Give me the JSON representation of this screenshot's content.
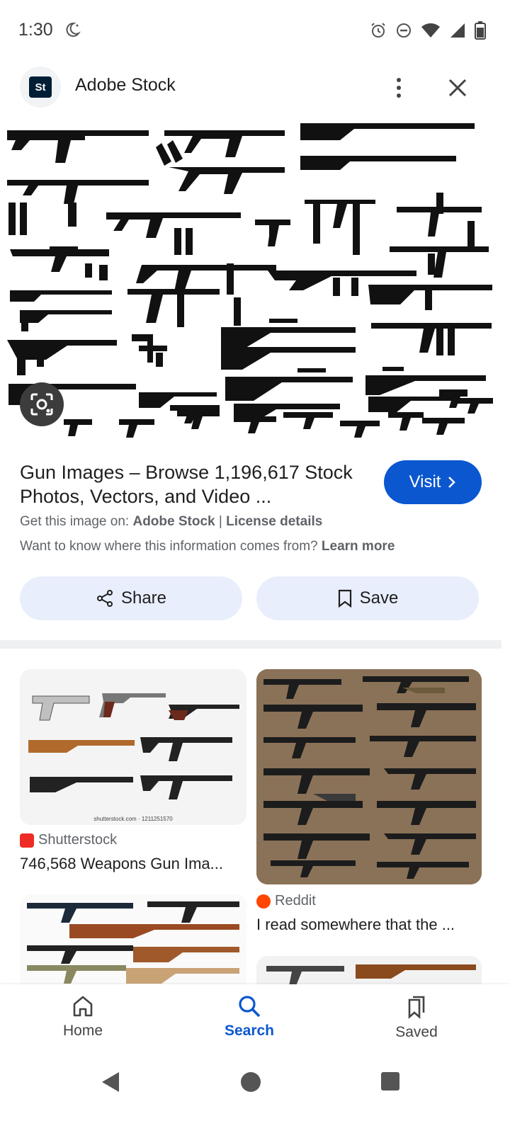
{
  "status_bar": {
    "time": "1:30"
  },
  "header": {
    "source_logo_text": "St",
    "title": "Adobe Stock"
  },
  "result": {
    "title": "Gun Images – Browse 1,196,617 Stock Photos, Vectors, and Video ...",
    "visit_label": "Visit",
    "get_prefix": "Get this image on: ",
    "get_source": "Adobe Stock",
    "get_separator": " | ",
    "license_label": "License details",
    "know_text": "Want to know where this information comes from? ",
    "learn_more": "Learn more"
  },
  "actions": {
    "share_label": "Share",
    "save_label": "Save"
  },
  "related": [
    {
      "source": "Shutterstock",
      "title": "746,568 Weapons Gun Ima...",
      "watermark": "shutterstock.com · 1211251570",
      "favicon_color": "#ee2b24"
    },
    {
      "source": "Reddit",
      "title": "I read somewhere that the ...",
      "favicon_color": "#ff4500"
    }
  ],
  "bottom_nav": {
    "home": "Home",
    "search": "Search",
    "saved": "Saved"
  },
  "colors": {
    "accent": "#0b57d0",
    "chip_bg": "#e8eefb"
  }
}
